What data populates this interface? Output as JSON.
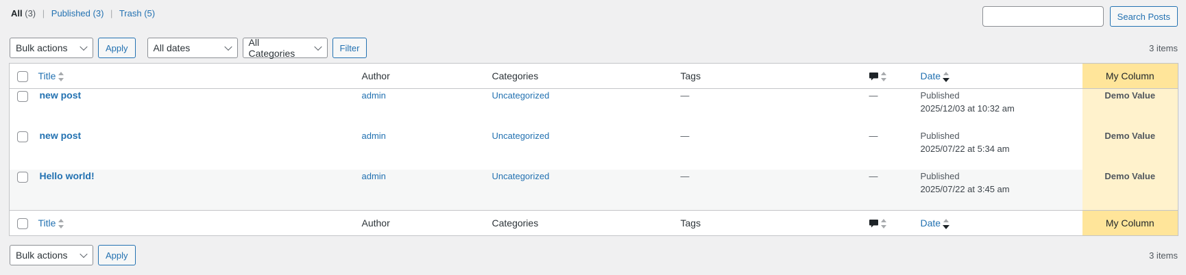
{
  "views": [
    {
      "label": "All",
      "count": "(3)",
      "current": true
    },
    {
      "label": "Published",
      "count": "(3)",
      "current": false
    },
    {
      "label": "Trash",
      "count": "(5)",
      "current": false
    }
  ],
  "view_separator": "|",
  "search": {
    "value": "",
    "button_label": "Search Posts"
  },
  "tablenav_top": {
    "bulk_actions": "Bulk actions",
    "apply_label": "Apply",
    "dates_filter": "All dates",
    "categories_filter": "All Categories",
    "filter_label": "Filter",
    "items_count": "3 items"
  },
  "tablenav_bottom": {
    "bulk_actions": "Bulk actions",
    "apply_label": "Apply",
    "items_count": "3 items"
  },
  "columns": {
    "title": "Title",
    "author": "Author",
    "categories": "Categories",
    "tags": "Tags",
    "comments_icon": "comment-icon",
    "date": "Date",
    "my_column": "My Column"
  },
  "sort": {
    "active_column": "date",
    "direction": "desc"
  },
  "rows": [
    {
      "title": "new post",
      "author": "admin",
      "categories": "Uncategorized",
      "tags": "—",
      "comments": "—",
      "date_status": "Published",
      "date_value": "2025/12/03 at 10:32 am",
      "my_column": "Demo Value"
    },
    {
      "title": "new post",
      "author": "admin",
      "categories": "Uncategorized",
      "tags": "—",
      "comments": "—",
      "date_status": "Published",
      "date_value": "2025/07/22 at 5:34 am",
      "my_column": "Demo Value"
    },
    {
      "title": "Hello world!",
      "author": "admin",
      "categories": "Uncategorized",
      "tags": "—",
      "comments": "—",
      "date_status": "Published",
      "date_value": "2025/07/22 at 3:45 am",
      "my_column": "Demo Value"
    }
  ],
  "colors": {
    "link": "#2271b1",
    "my_column_header": "#ffe59a",
    "my_column_cell": "#fff2cc",
    "page_bg": "#f0f0f1"
  }
}
